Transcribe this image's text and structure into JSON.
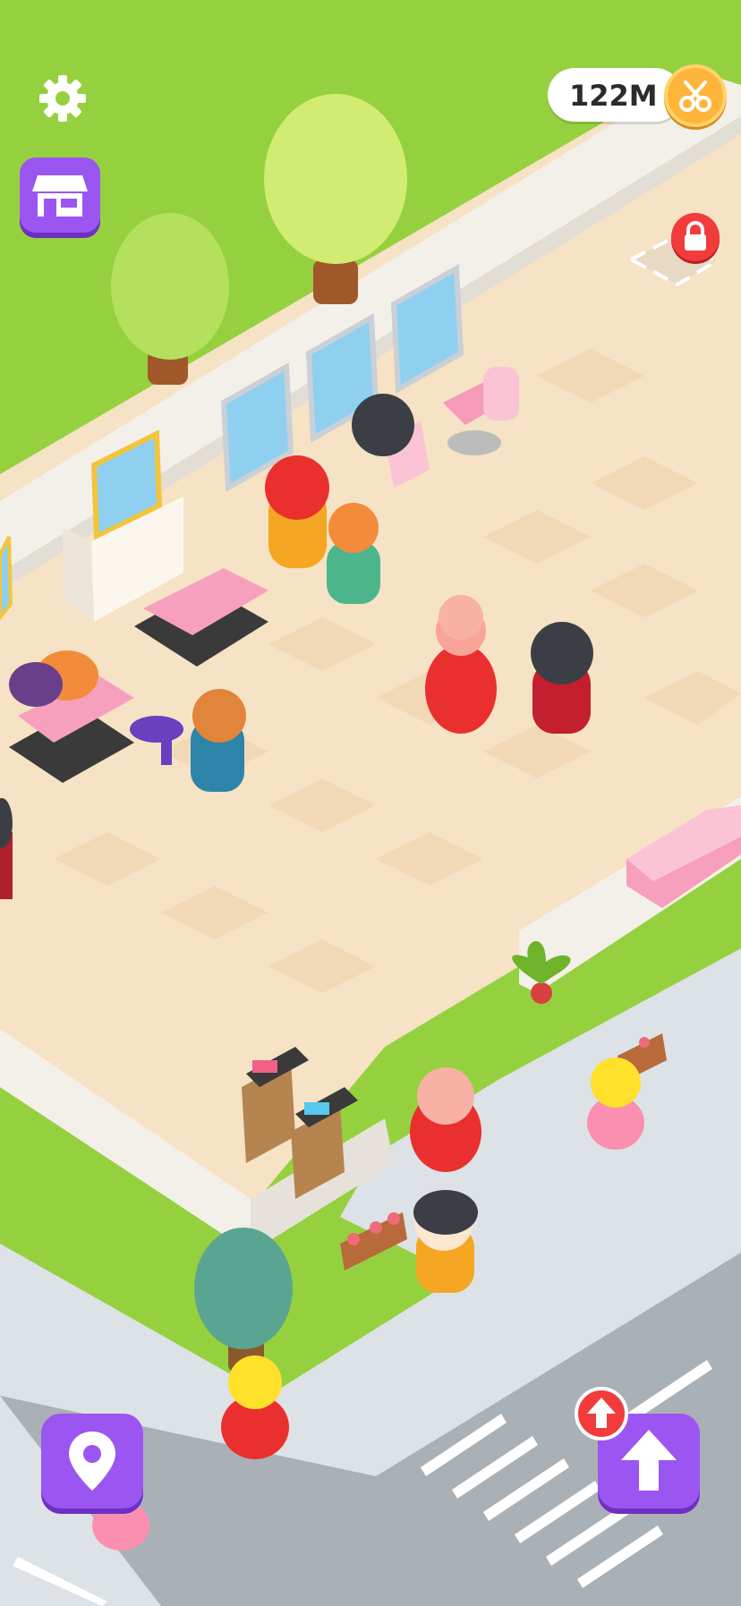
{
  "hud": {
    "coins": "122M",
    "icons": {
      "settings": "gear-icon",
      "shop": "shop-icon",
      "coin": "scissors-coin-icon",
      "locked_slot": "lock-icon",
      "map": "location-pin-icon",
      "upgrade": "arrow-up-icon",
      "upgrade_notice": "arrow-up-badge-icon"
    }
  },
  "colors": {
    "grass": "#95d13f",
    "floor": "#f6e2c4",
    "wall": "#f3f0ea",
    "road": "#dde2e6",
    "street": "#a9b0b6",
    "button": "#9b55f0",
    "alert": "#f23b3b",
    "coin": "#ffb43a"
  }
}
